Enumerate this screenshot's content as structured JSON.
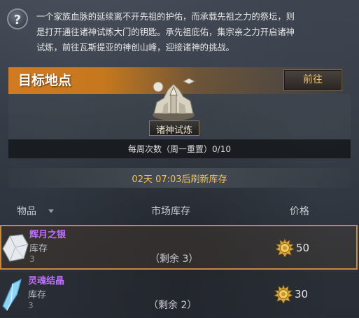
{
  "description": {
    "lines": [
      "一个家族血脉的延续离不开先祖的护佑，而承载先祖之力的祭坛，则",
      "是打开通往诸神试炼大门的钥匙。承先祖庇佑，集宗亲之力开启诸神",
      "试炼，前往瓦斯提亚的神创山峰，迎接诸神的挑战。"
    ]
  },
  "target": {
    "title": "目标地点",
    "goto_label": "前往",
    "destination_name": "诸神试炼",
    "weekly_count": "每周次数（周一重置）0/10"
  },
  "refresh_text": "02天 07:03后刷新库存",
  "table": {
    "headers": {
      "item": "物品",
      "stock": "市场库存",
      "price": "价格"
    },
    "rows": [
      {
        "name": "辉月之银",
        "stock_label": "库存",
        "stock_value": "3",
        "remaining": "（剩余 3）",
        "price": "50"
      },
      {
        "name": "灵魂结晶",
        "stock_label": "库存",
        "stock_value": "3",
        "remaining": "（剩余 2）",
        "price": "30"
      }
    ]
  },
  "colors": {
    "accent_orange": "#d27a21",
    "gold_text": "#f2c25a",
    "item_name_purple": "#c070ff",
    "selected_border": "#c8893b"
  },
  "icons": [
    "help-icon",
    "destination-icon",
    "sort-icon",
    "silver-ore-icon",
    "soul-crystal-icon",
    "gold-coin-icon"
  ]
}
